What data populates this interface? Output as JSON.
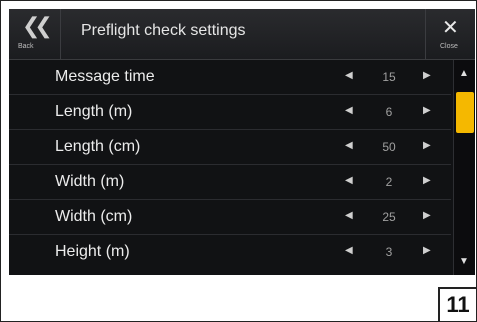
{
  "header": {
    "back_label": "Back",
    "title": "Preflight check settings",
    "close_label": "Close"
  },
  "settings": [
    {
      "label": "Message time",
      "value": "15"
    },
    {
      "label": "Length (m)",
      "value": "6"
    },
    {
      "label": "Length (cm)",
      "value": "50"
    },
    {
      "label": "Width (m)",
      "value": "2"
    },
    {
      "label": "Width (cm)",
      "value": "25"
    },
    {
      "label": "Height (m)",
      "value": "3"
    }
  ],
  "icons": {
    "back": "double-chevron-left-icon",
    "close": "close-icon",
    "decrease": "triangle-left-icon",
    "increase": "triangle-right-icon",
    "scroll_up": "triangle-up-icon",
    "scroll_down": "triangle-down-icon"
  },
  "colors": {
    "accent": "#f5b800",
    "background": "#111214",
    "header": "#232427"
  },
  "scroll_position": 0.1,
  "page_number": "11"
}
